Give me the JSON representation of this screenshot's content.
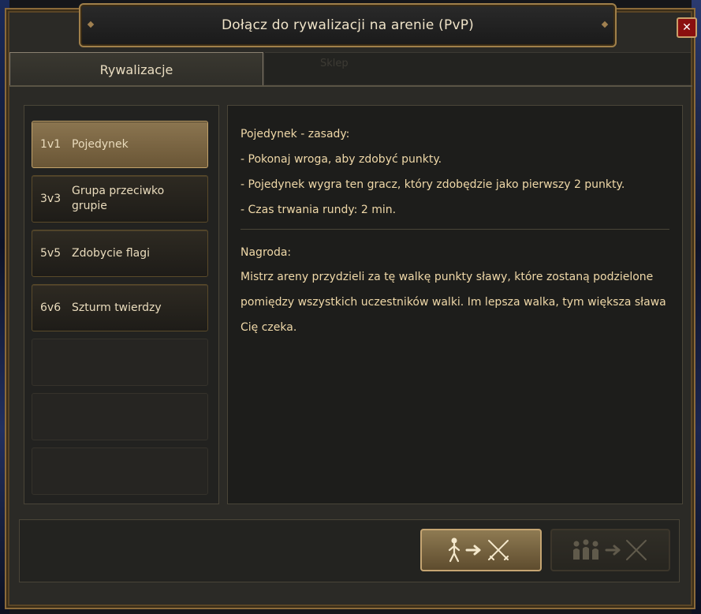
{
  "window": {
    "title": "Dołącz do rywalizacji na arenie (PvP)",
    "close_icon": "close-icon"
  },
  "tabs": [
    {
      "label": "Rywalizacje",
      "active": true
    },
    {
      "label": "Sklep",
      "active": false
    }
  ],
  "arenas": [
    {
      "code": "1v1",
      "name": "Pojedynek",
      "selected": true
    },
    {
      "code": "3v3",
      "name": "Grupa przeciwko grupie",
      "selected": false
    },
    {
      "code": "5v5",
      "name": "Zdobycie flagi",
      "selected": false
    },
    {
      "code": "6v6",
      "name": "Szturm twierdzy",
      "selected": false
    }
  ],
  "details": {
    "rules_title": "Pojedynek - zasady:",
    "rules": [
      "- Pokonaj wroga, aby zdobyć punkty.",
      "- Pojedynek wygra ten gracz, który zdobędzie jako pierwszy 2 punkty.",
      "- Czas trwania rundy: 2 min."
    ],
    "reward_title": "Nagroda:",
    "reward_text": "Mistrz areny przydzieli za tę walkę punkty sławy, które zostaną podzielone pomiędzy wszystkich uczestników walki. Im lepsza walka, tym większa sława Cię czeka."
  },
  "buttons": {
    "join_solo_icon": "solo-join-icon",
    "join_group_icon": "group-join-icon"
  },
  "colors": {
    "accent_gold": "#c5a572",
    "text": "#efd8a8",
    "close_red": "#8a0f0f"
  }
}
